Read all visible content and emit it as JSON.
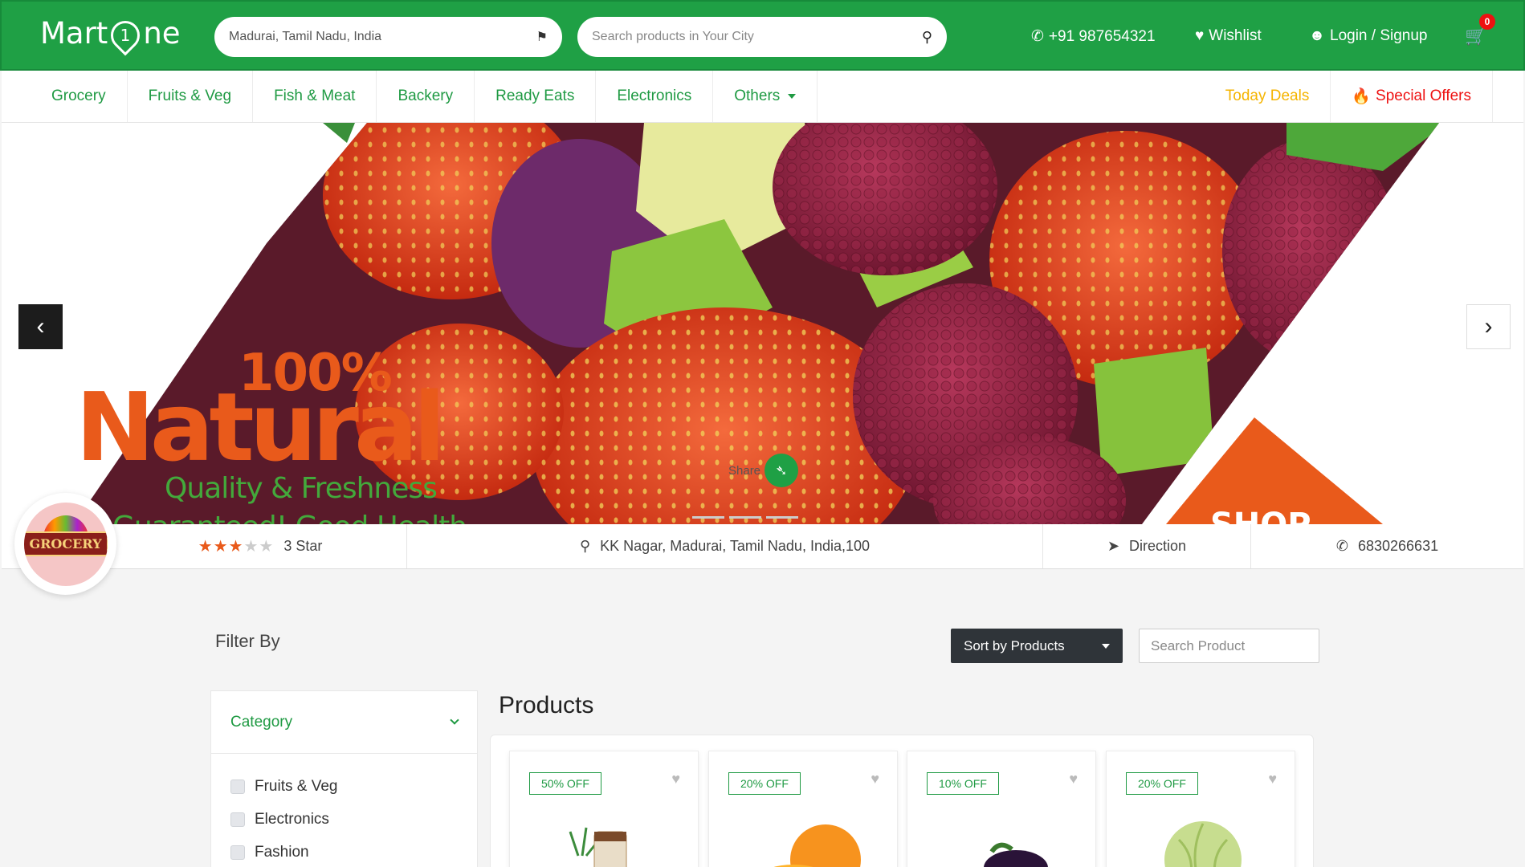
{
  "header": {
    "logo_text_left": "Mart",
    "logo_text_right": "ne",
    "location": "Madurai, Tamil Nadu, India",
    "search_placeholder": "Search products in Your City",
    "phone": "+91 987654321",
    "wishlist": "Wishlist",
    "login": "Login / Signup",
    "cart_count": "0"
  },
  "nav": {
    "items": [
      "Grocery",
      "Fruits & Veg",
      "Fish & Meat",
      "Backery",
      "Ready Eats",
      "Electronics",
      "Others"
    ],
    "today_deals": "Today Deals",
    "special_offers": "Special Offers"
  },
  "banner": {
    "line1": "100%",
    "line2": "Natural",
    "line3": "Quality & Freshness",
    "line4": "Guaranteed! Good Health",
    "shop": "SHOP",
    "share": "Share"
  },
  "store": {
    "logo_text": "GROCERY",
    "rating_stars": 3,
    "rating_label": "3 Star",
    "address": "KK Nagar, Madurai, Tamil Nadu, India,100",
    "direction": "Direction",
    "phone": "6830266631"
  },
  "filter": {
    "title": "Filter By",
    "sort_label": "Sort by Products",
    "search_placeholder": "Search Product",
    "category_label": "Category",
    "categories": [
      "Fruits & Veg",
      "Electronics",
      "Fashion"
    ]
  },
  "products": {
    "title": "Products",
    "cards": [
      {
        "discount": "50% OFF",
        "image": "coconut-jar"
      },
      {
        "discount": "20% OFF",
        "image": "orange"
      },
      {
        "discount": "10% OFF",
        "image": "eggplant"
      },
      {
        "discount": "20% OFF",
        "image": "cabbage"
      }
    ]
  },
  "colors": {
    "brand_green": "#1fa045",
    "accent_orange": "#e95a1b",
    "deal_yellow": "#f5b400",
    "offer_red": "#ee1111"
  }
}
